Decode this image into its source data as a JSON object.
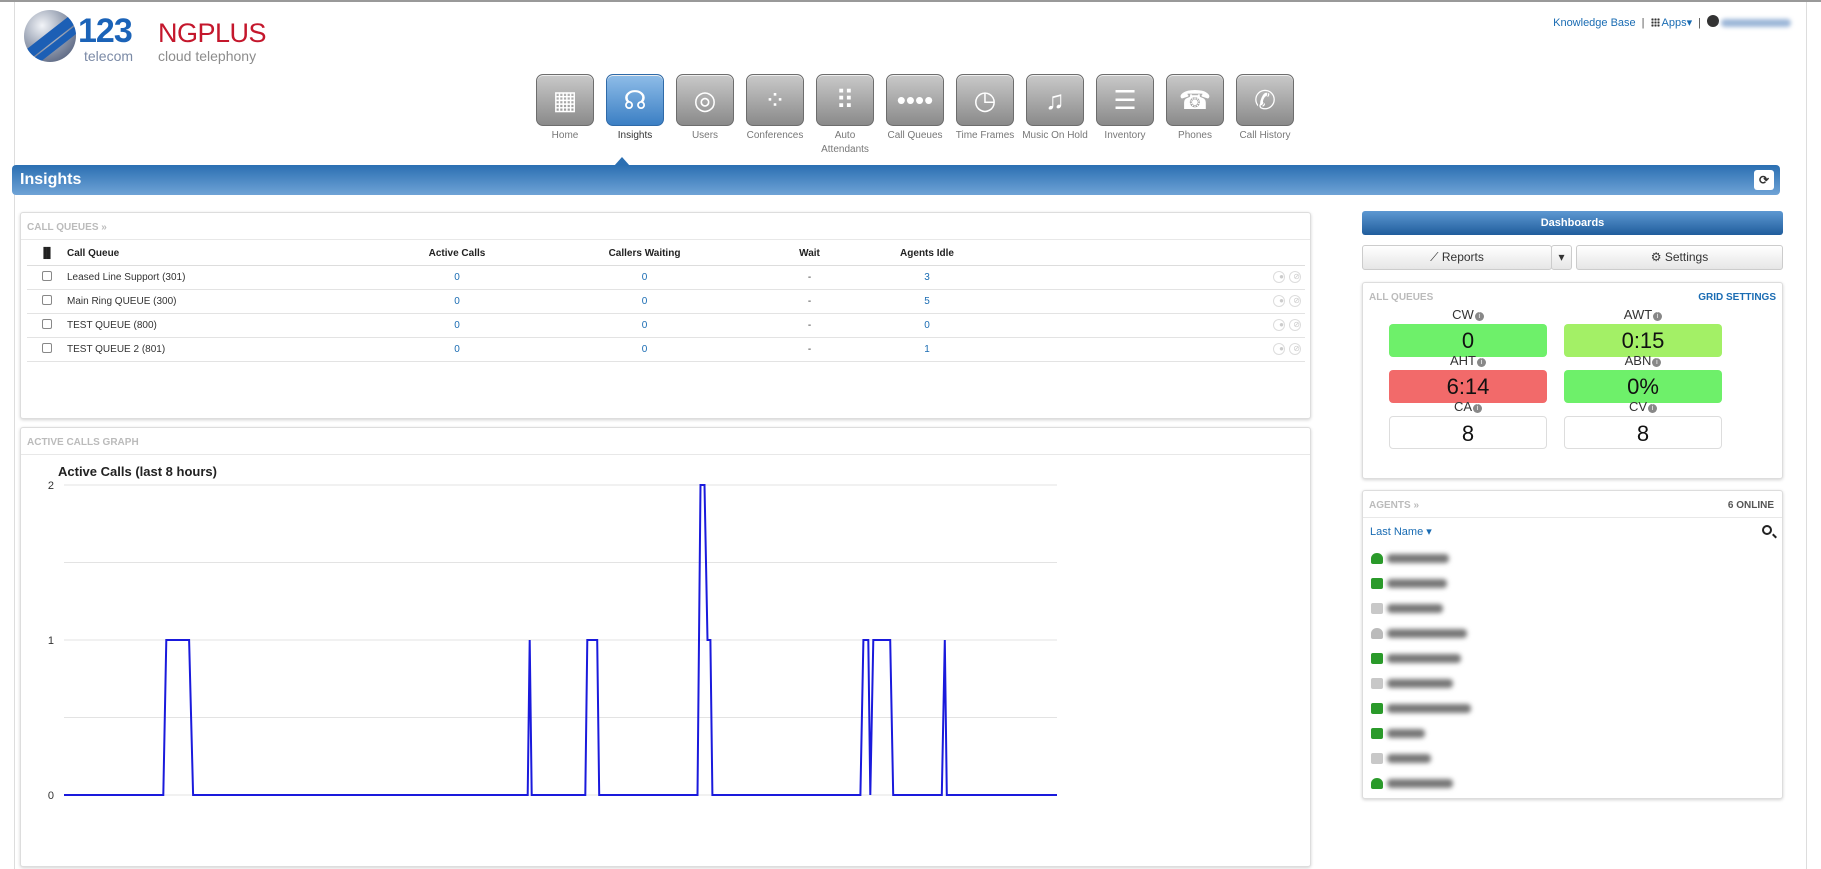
{
  "header": {
    "logo_number": "123",
    "logo_sub": "telecom",
    "brand": "NGPLUS",
    "brand_sub": "cloud telephony",
    "links": {
      "knowledge_base": "Knowledge Base",
      "apps": "Apps",
      "sep": "|"
    }
  },
  "nav": [
    {
      "label": "Home",
      "icon": "building-icon",
      "glyph": "▦",
      "active": false
    },
    {
      "label": "Insights",
      "icon": "headset-icon",
      "glyph": "☊",
      "active": true
    },
    {
      "label": "Users",
      "icon": "users-icon",
      "glyph": "◎",
      "active": false
    },
    {
      "label": "Conferences",
      "icon": "conference-icon",
      "glyph": "⁘",
      "active": false
    },
    {
      "label": "Auto Attendants",
      "icon": "keypad-icon",
      "glyph": "⠿",
      "active": false
    },
    {
      "label": "Call Queues",
      "icon": "queue-icon",
      "glyph": "••••",
      "active": false
    },
    {
      "label": "Time Frames",
      "icon": "clock-icon",
      "glyph": "◷",
      "active": false
    },
    {
      "label": "Music On Hold",
      "icon": "music-icon",
      "glyph": "♫",
      "active": false
    },
    {
      "label": "Inventory",
      "icon": "list-icon",
      "glyph": "☰",
      "active": false
    },
    {
      "label": "Phones",
      "icon": "phone-icon",
      "glyph": "☎",
      "active": false
    },
    {
      "label": "Call History",
      "icon": "call-history-icon",
      "glyph": "✆",
      "active": false
    }
  ],
  "page_title": "Insights",
  "call_queues": {
    "heading": "CALL QUEUES »",
    "columns": [
      "Call Queue",
      "Active Calls",
      "Callers Waiting",
      "Wait",
      "Agents Idle"
    ],
    "rows": [
      {
        "name": "Leased Line Support (301)",
        "active": "0",
        "waiting": "0",
        "wait": "-",
        "idle": "3"
      },
      {
        "name": "Main Ring QUEUE (300)",
        "active": "0",
        "waiting": "0",
        "wait": "-",
        "idle": "5"
      },
      {
        "name": "TEST QUEUE (800)",
        "active": "0",
        "waiting": "0",
        "wait": "-",
        "idle": "0"
      },
      {
        "name": "TEST QUEUE 2 (801)",
        "active": "0",
        "waiting": "0",
        "wait": "-",
        "idle": "1"
      }
    ]
  },
  "graph": {
    "heading": "ACTIVE CALLS GRAPH",
    "title": "Active Calls (last 8 hours)"
  },
  "chart_data": {
    "type": "line",
    "title": "Active Calls (last 8 hours)",
    "ylim": [
      0,
      2
    ],
    "yticks": [
      "0",
      "1",
      "2"
    ],
    "series": [
      {
        "color": "#1a1adc",
        "points": [
          [
            0,
            0
          ],
          [
            0.1,
            0
          ],
          [
            0.103,
            1
          ],
          [
            0.126,
            1
          ],
          [
            0.13,
            0
          ],
          [
            0.467,
            0
          ],
          [
            0.469,
            1
          ],
          [
            0.471,
            0
          ],
          [
            0.525,
            0
          ],
          [
            0.527,
            1
          ],
          [
            0.537,
            1
          ],
          [
            0.539,
            0
          ],
          [
            0.638,
            0
          ],
          [
            0.641,
            2
          ],
          [
            0.645,
            2
          ],
          [
            0.648,
            1
          ],
          [
            0.651,
            1
          ],
          [
            0.653,
            0
          ],
          [
            0.802,
            0
          ],
          [
            0.805,
            1
          ],
          [
            0.81,
            1
          ],
          [
            0.812,
            0
          ],
          [
            0.815,
            1
          ],
          [
            0.832,
            1
          ],
          [
            0.835,
            0
          ],
          [
            0.884,
            0
          ],
          [
            0.887,
            1
          ],
          [
            0.889,
            0
          ],
          [
            1,
            0
          ]
        ]
      }
    ]
  },
  "dashboards": {
    "title": "Dashboards",
    "reports_label": "Reports",
    "settings_label": "Settings"
  },
  "all_queues": {
    "heading": "ALL QUEUES",
    "grid_settings": "GRID SETTINGS",
    "stats": [
      {
        "label": "CW",
        "value": "0",
        "color": "#6ef06a"
      },
      {
        "label": "AWT",
        "value": "0:15",
        "color": "#a3f066"
      },
      {
        "label": "AHT",
        "value": "6:14",
        "color": "#f26a6a"
      },
      {
        "label": "ABN",
        "value": "0%",
        "color": "#6ef06a"
      },
      {
        "label": "CA",
        "value": "8",
        "color": "#ffffff"
      },
      {
        "label": "CV",
        "value": "8",
        "color": "#ffffff"
      }
    ]
  },
  "agents": {
    "heading": "AGENTS »",
    "online": "6 ONLINE",
    "sort_label": "Last Name",
    "list": [
      {
        "status": "person-green",
        "name_width": 62
      },
      {
        "status": "green",
        "name_width": 60
      },
      {
        "status": "grey",
        "name_width": 56
      },
      {
        "status": "person-grey",
        "name_width": 80
      },
      {
        "status": "green",
        "name_width": 74
      },
      {
        "status": "grey",
        "name_width": 66
      },
      {
        "status": "green",
        "name_width": 84
      },
      {
        "status": "green",
        "name_width": 38
      },
      {
        "status": "grey",
        "name_width": 44
      },
      {
        "status": "person-green",
        "name_width": 66
      }
    ]
  }
}
